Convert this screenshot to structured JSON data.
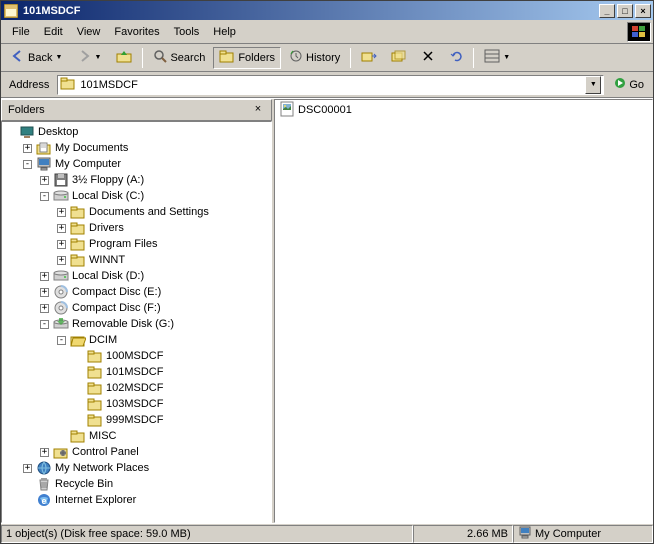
{
  "title": "101MSDCF",
  "menu": [
    "File",
    "Edit",
    "View",
    "Favorites",
    "Tools",
    "Help"
  ],
  "toolbar": {
    "back": "Back",
    "search": "Search",
    "folders": "Folders",
    "history": "History"
  },
  "address": {
    "label": "Address",
    "value": "101MSDCF",
    "go": "Go"
  },
  "folders_panel": {
    "title": "Folders"
  },
  "tree": {
    "desktop": "Desktop",
    "mydocs": "My Documents",
    "mycomputer": "My Computer",
    "floppy": "3½ Floppy (A:)",
    "localc": "Local Disk (C:)",
    "docsettings": "Documents and Settings",
    "drivers": "Drivers",
    "progfiles": "Program Files",
    "winnt": "WINNT",
    "locald": "Local Disk (D:)",
    "cde": "Compact Disc (E:)",
    "cdf": "Compact Disc (F:)",
    "removg": "Removable Disk (G:)",
    "dcim": "DCIM",
    "f100": "100MSDCF",
    "f101": "101MSDCF",
    "f102": "102MSDCF",
    "f103": "103MSDCF",
    "f999": "999MSDCF",
    "misc": "MISC",
    "cpanel": "Control Panel",
    "netplaces": "My Network Places",
    "recycle": "Recycle Bin",
    "ie": "Internet Explorer"
  },
  "files": {
    "item1": "DSC00001"
  },
  "status": {
    "objects": "1 object(s) (Disk free space: 59.0 MB)",
    "size": "2.66 MB",
    "location": "My Computer"
  }
}
